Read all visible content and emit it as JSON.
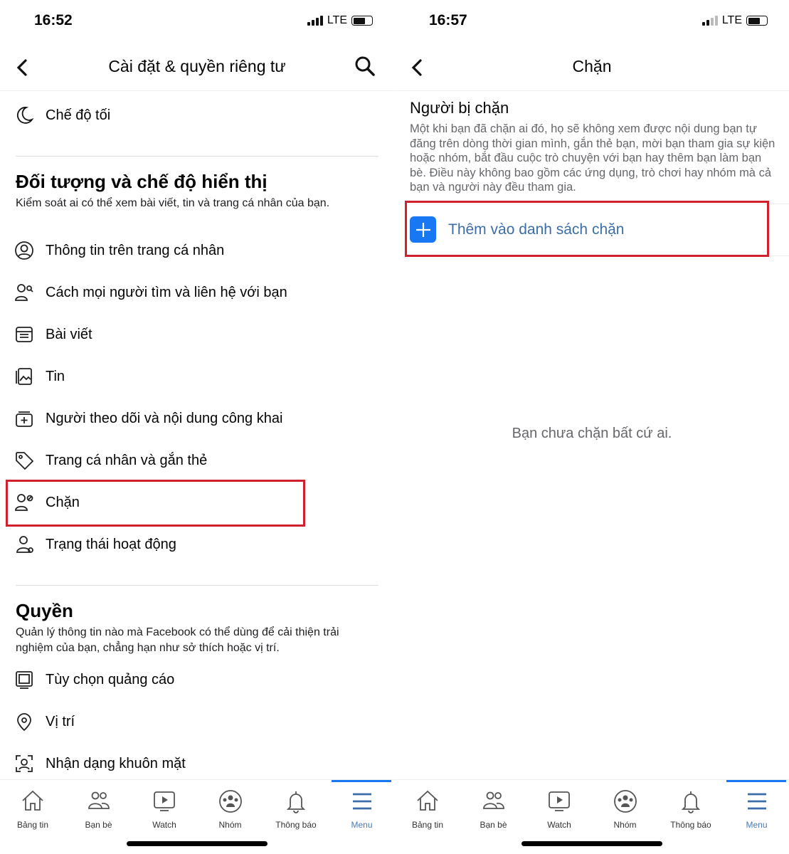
{
  "left": {
    "status": {
      "time": "16:52",
      "network": "LTE"
    },
    "header": {
      "title": "Cài đặt & quyền riêng tư"
    },
    "dark_mode": "Chế độ tối",
    "audience": {
      "title": "Đối tượng và chế độ hiển thị",
      "description": "Kiểm soát ai có thể xem bài viết, tin và trang cá nhân của bạn.",
      "items": [
        {
          "label": "Thông tin trên trang cá nhân",
          "icon": "profile-icon"
        },
        {
          "label": "Cách mọi người tìm và liên hệ với bạn",
          "icon": "people-search-icon"
        },
        {
          "label": "Bài viết",
          "icon": "posts-icon"
        },
        {
          "label": "Tin",
          "icon": "stories-icon"
        },
        {
          "label": "Người theo dõi và nội dung công khai",
          "icon": "followers-icon"
        },
        {
          "label": "Trang cá nhân và gắn thẻ",
          "icon": "tag-icon"
        },
        {
          "label": "Chặn",
          "icon": "block-user-icon"
        },
        {
          "label": "Trạng thái hoạt động",
          "icon": "active-status-icon"
        }
      ]
    },
    "permissions": {
      "title": "Quyền",
      "description": "Quản lý thông tin nào mà Facebook có thể dùng để cải thiện trải nghiệm của bạn, chẳng hạn như sở thích hoặc vị trí.",
      "items": [
        {
          "label": "Tùy chọn quảng cáo",
          "icon": "ads-icon"
        },
        {
          "label": "Vị trí",
          "icon": "location-icon"
        },
        {
          "label": "Nhận dạng khuôn mặt",
          "icon": "face-recognition-icon"
        }
      ]
    }
  },
  "right": {
    "status": {
      "time": "16:57",
      "network": "LTE"
    },
    "header": {
      "title": "Chặn"
    },
    "section_title": "Người bị chặn",
    "description": "Một khi bạn đã chặn ai đó, họ sẽ không xem được nội dung bạn tự đăng trên dòng thời gian mình, gắn thẻ bạn, mời bạn tham gia sự kiện hoặc nhóm, bắt đầu cuộc trò chuyện với bạn hay thêm bạn làm bạn bè. Điều này không bao gồm các ứng dụng, trò chơi hay nhóm mà cả bạn và người này đều tham gia.",
    "add_button": "Thêm vào danh sách chặn",
    "empty_state": "Bạn chưa chặn bất cứ ai."
  },
  "nav": [
    {
      "label": "Bảng tin"
    },
    {
      "label": "Bạn bè"
    },
    {
      "label": "Watch"
    },
    {
      "label": "Nhóm"
    },
    {
      "label": "Thông báo"
    },
    {
      "label": "Menu",
      "active": true
    }
  ],
  "colors": {
    "accent": "#1877f2",
    "highlight": "#d0202e",
    "link": "#3b6ea8"
  }
}
